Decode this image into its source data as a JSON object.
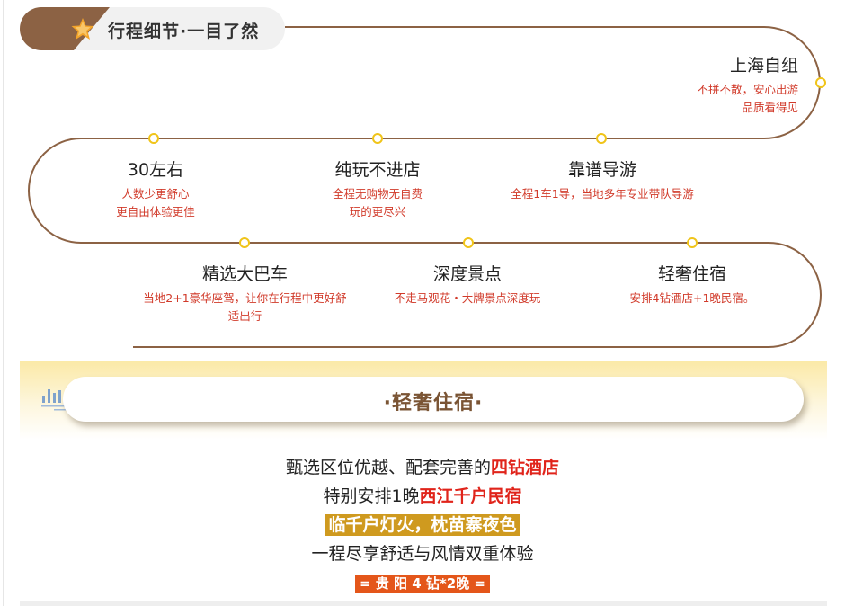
{
  "header": {
    "title": "行程细节·一目了然"
  },
  "features": [
    {
      "id": "shanghai",
      "title": "上海自组",
      "desc": [
        "不拼不散，安心出游",
        "品质看得见"
      ]
    },
    {
      "id": "group-size",
      "title": "30左右",
      "desc": [
        "人数少更舒心",
        "更自由体验更佳"
      ]
    },
    {
      "id": "no-shopping",
      "title": "纯玩不进店",
      "desc": [
        "全程无购物无自费",
        "玩的更尽兴"
      ]
    },
    {
      "id": "guide",
      "title": "靠谱导游",
      "desc": [
        "全程1车1导，当地多年专业带队导游"
      ]
    },
    {
      "id": "bus",
      "title": "精选大巴车",
      "desc": [
        "当地2+1豪华座驾，让你在行程中更好舒",
        "适出行"
      ]
    },
    {
      "id": "sights",
      "title": "深度景点",
      "desc": [
        "不走马观花・大牌景点深度玩"
      ]
    },
    {
      "id": "hotel",
      "title": "轻奢住宿",
      "desc": [
        "安排4钻酒店+1晚民宿。"
      ]
    }
  ],
  "section": {
    "title": "·轻奢住宿·"
  },
  "accommodation": {
    "line1": {
      "text": "甄选区位优越、配套完善的",
      "highlight": "四钻酒店"
    },
    "line2": {
      "text": "特别安排1晚",
      "highlight": "西江千户民宿"
    },
    "line3": {
      "tag": "临千户灯火，枕苗寨夜色"
    },
    "line4": {
      "text": "一程尽享舒适与风情双重体验"
    },
    "line5": {
      "tag": "= 贵 阳 4 钻*2晚 ="
    }
  },
  "colors": {
    "route_line": "#8c6244",
    "route_dot": "#f0c419",
    "desc_text": "#d13a2a",
    "highlight_red": "#e0241b",
    "tag_gold": "#cf9a1f",
    "tag_orange": "#e4561a",
    "band_yellow": "#fbe9a6"
  },
  "icons": {
    "header": "star-icon",
    "section": "bar-chart-icon"
  }
}
